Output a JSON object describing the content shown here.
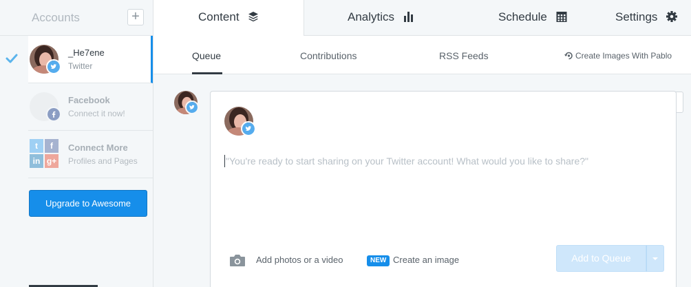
{
  "sidebar": {
    "title": "Accounts",
    "add_label": "+",
    "accounts": [
      {
        "name": "_He7ene",
        "sub": "Twitter",
        "network_icon": "twitter-icon",
        "selected": true
      },
      {
        "name": "Facebook",
        "sub": "Connect it now!",
        "network_icon": "facebook-icon",
        "selected": false
      },
      {
        "name": "Connect More",
        "sub": "Profiles and Pages",
        "network_icon": "social-grid-icon",
        "selected": false
      }
    ],
    "connect_more_grid": [
      "t",
      "f",
      "in",
      "g+"
    ],
    "upgrade_label": "Upgrade to Awesome"
  },
  "tabs": [
    {
      "label": "Content",
      "icon": "layers-icon",
      "active": true
    },
    {
      "label": "Analytics",
      "icon": "bar-chart-icon",
      "active": false
    },
    {
      "label": "Schedule",
      "icon": "calendar-icon",
      "active": false
    },
    {
      "label": "Settings",
      "icon": "gear-icon",
      "active": false
    }
  ],
  "subtabs": [
    {
      "label": "Queue",
      "active": true
    },
    {
      "label": "Contributions",
      "active": false
    },
    {
      "label": "RSS Feeds",
      "active": false
    }
  ],
  "pablo_label": "Create Images With Pablo",
  "composer": {
    "placeholder": "\"You're ready to start sharing on your Twitter account! What would you like to share?\"",
    "add_media_label": "Add photos or a video",
    "new_badge": "NEW",
    "create_image_label": "Create an image",
    "queue_label": "Add to Queue"
  },
  "colors": {
    "accent": "#168eea",
    "sidebar_bg": "#f4f7f9",
    "text_dark": "#323b43",
    "twitter": "#55acee",
    "facebook": "#8b9dc3"
  }
}
